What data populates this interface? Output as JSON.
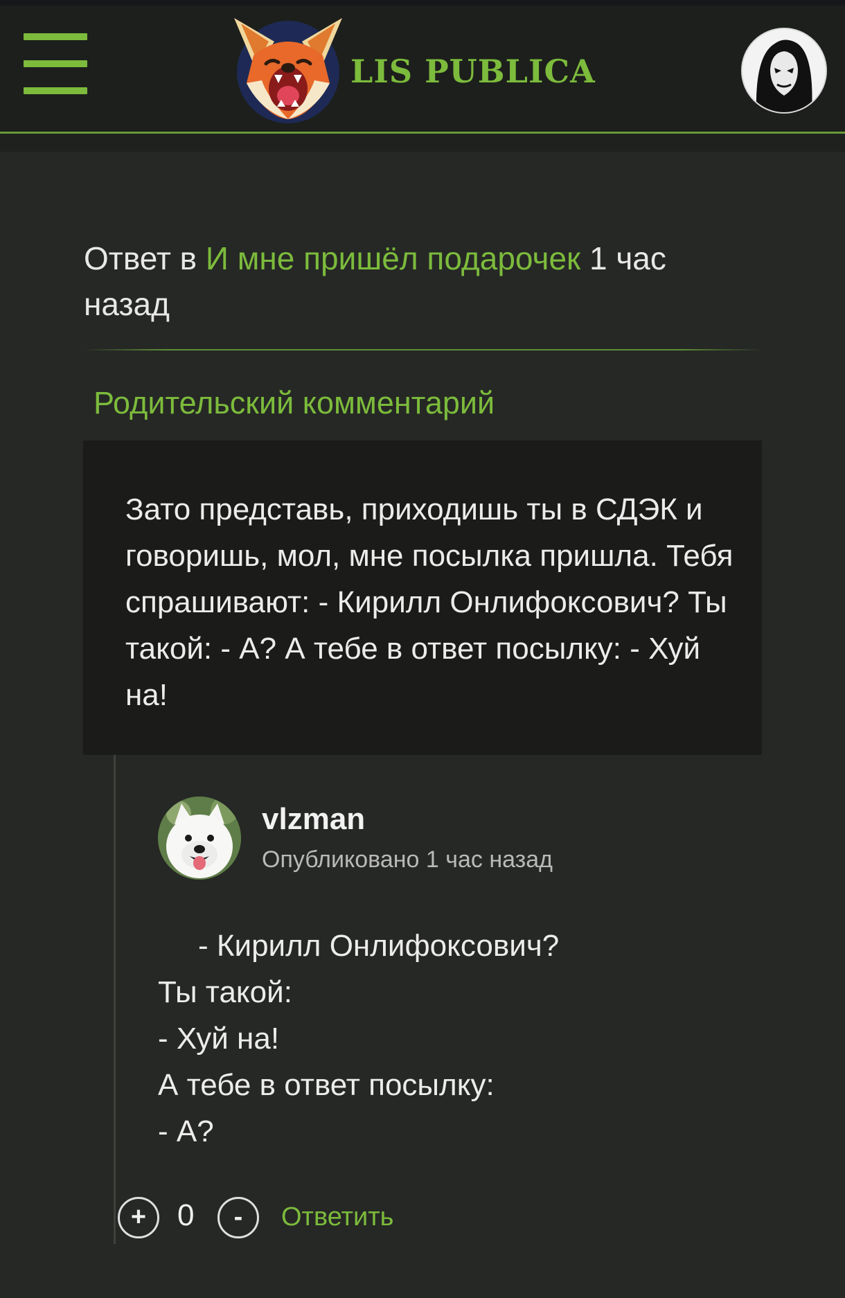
{
  "colors": {
    "accent": "#7cbb3c",
    "background": "#262825",
    "header_bg": "#1d1f1c",
    "box_bg": "#1b1c1a",
    "text": "#ececec",
    "muted": "#b9b9b9"
  },
  "header": {
    "menu_icon": "hamburger-icon",
    "logo_icon": "fox-logo-icon",
    "logo_text": "LIS PUBLICA",
    "user_avatar_icon": "user-avatar-icon"
  },
  "reply_meta": {
    "prefix": "Ответ в ",
    "thread_title": "И мне пришёл подарочек",
    "time": " 1 час назад"
  },
  "parent": {
    "heading": "Родительский комментарий",
    "text": "Зато представь, приходишь ты в СДЭК и говоришь, мол, мне посылка пришла. Тебя спрашивают: - Кирилл Онлифоксович? Ты такой: - А? А тебе в ответ посылку: - Хуй на!"
  },
  "comment": {
    "username": "vlzman",
    "avatar_icon": "dog-avatar-icon",
    "published": "Опубликовано 1 час назад",
    "lines": [
      "- Кирилл Онлифоксович?",
      "Ты такой:",
      "- Хуй на!",
      "А тебе в ответ посылку:",
      "- А?"
    ],
    "vote_up": "+",
    "vote_count": "0",
    "vote_down": "-",
    "reply_label": "Ответить"
  }
}
